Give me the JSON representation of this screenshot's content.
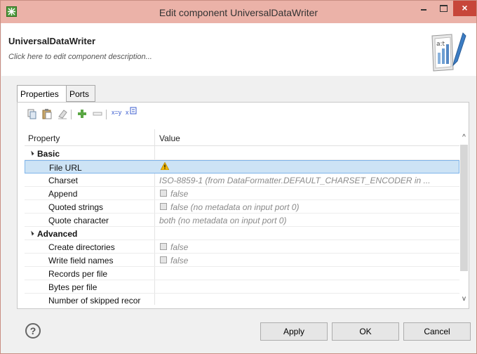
{
  "window": {
    "title": "Edit component UniversalDataWriter",
    "close_glyph": "×"
  },
  "header": {
    "component_name": "UniversalDataWriter",
    "description_placeholder": "Click here to edit component description..."
  },
  "tabs": [
    {
      "label": "Properties",
      "active": true
    },
    {
      "label": "Ports",
      "active": false
    }
  ],
  "toolbar": {
    "items": [
      "copy-icon",
      "paste-icon",
      "eraser-icon",
      "add-icon",
      "remove-icon"
    ],
    "xy_label": "x=y",
    "x_label": "x"
  },
  "table": {
    "headers": {
      "property": "Property",
      "value": "Value"
    },
    "categories": [
      {
        "label": "Basic",
        "rows": [
          {
            "name": "File URL",
            "value": "",
            "selected": true,
            "warning": true
          },
          {
            "name": "Charset",
            "value": "ISO-8859-1 (from DataFormatter.DEFAULT_CHARSET_ENCODER in ..."
          },
          {
            "name": "Append",
            "value": "false",
            "checkbox": true
          },
          {
            "name": "Quoted strings",
            "value": "false (no metadata on input port 0)",
            "checkbox": true
          },
          {
            "name": "Quote character",
            "value": "both (no metadata on input port 0)"
          }
        ]
      },
      {
        "label": "Advanced",
        "rows": [
          {
            "name": "Create directories",
            "value": "false",
            "checkbox": true
          },
          {
            "name": "Write field names",
            "value": "false",
            "checkbox": true
          },
          {
            "name": "Records per file",
            "value": ""
          },
          {
            "name": "Bytes per file",
            "value": ""
          },
          {
            "name": "Number of skipped recor",
            "value": ""
          }
        ]
      }
    ]
  },
  "footer": {
    "help_glyph": "?",
    "apply_label": "Apply",
    "ok_label": "OK",
    "cancel_label": "Cancel"
  },
  "colors": {
    "titlebar": "#ebb2a8",
    "close_button": "#c7463a",
    "selection": "#cde3f5"
  }
}
